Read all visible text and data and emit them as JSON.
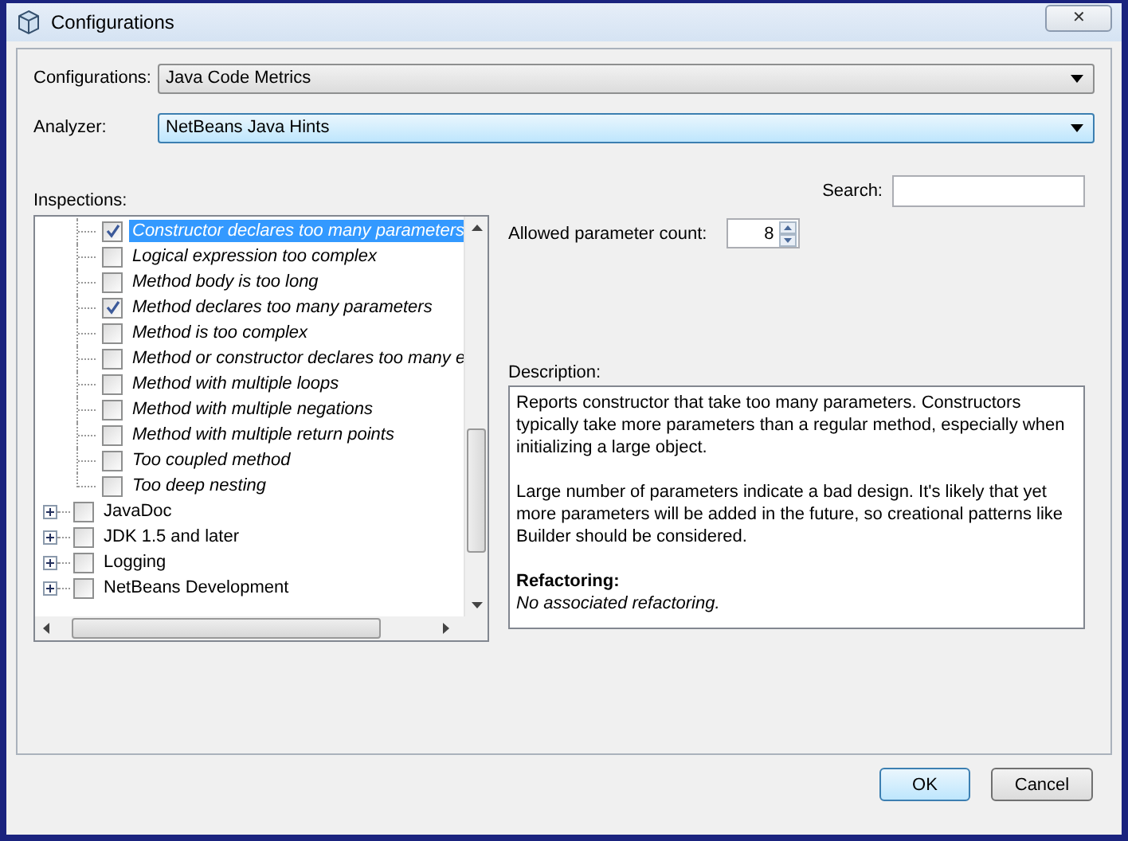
{
  "window": {
    "title": "Configurations",
    "close": "✕"
  },
  "configurations": {
    "label": "Configurations:",
    "value": "Java Code Metrics"
  },
  "analyzer": {
    "label": "Analyzer:",
    "value": "NetBeans Java Hints"
  },
  "inspections": {
    "label": "Inspections:",
    "open_group_children": [
      {
        "label": "Constructor declares too many parameters",
        "checked": true,
        "selected": true
      },
      {
        "label": "Logical expression too complex",
        "checked": false,
        "selected": false
      },
      {
        "label": "Method body is too long",
        "checked": false,
        "selected": false
      },
      {
        "label": "Method declares too many parameters",
        "checked": true,
        "selected": false
      },
      {
        "label": "Method is too complex",
        "checked": false,
        "selected": false
      },
      {
        "label": "Method or constructor declares too many e",
        "checked": false,
        "selected": false
      },
      {
        "label": "Method with multiple loops",
        "checked": false,
        "selected": false
      },
      {
        "label": "Method with multiple negations",
        "checked": false,
        "selected": false
      },
      {
        "label": "Method with multiple return points",
        "checked": false,
        "selected": false
      },
      {
        "label": "Too coupled method",
        "checked": false,
        "selected": false
      },
      {
        "label": "Too deep nesting",
        "checked": false,
        "selected": false
      }
    ],
    "groups": [
      {
        "label": "JavaDoc",
        "checked": false,
        "selected": false,
        "expanded": false
      },
      {
        "label": "JDK 1.5 and later",
        "checked": false,
        "selected": false,
        "expanded": false
      },
      {
        "label": "Logging",
        "checked": false,
        "selected": false,
        "expanded": false
      },
      {
        "label": "NetBeans Development",
        "checked": false,
        "selected": false,
        "expanded": false
      }
    ]
  },
  "search": {
    "label": "Search:"
  },
  "option": {
    "label": "Allowed parameter count:",
    "value": "8"
  },
  "description": {
    "label": "Description:",
    "paragraphs": [
      "Reports constructor that take too many parameters. Constructors typically take more parameters than a regular method, especially when initializing a large object.",
      "Large number of parameters indicate a bad design. It's likely that yet more parameters will be added in the future, so creational patterns like Builder should be considered."
    ],
    "refactoring_heading": "Refactoring:",
    "refactoring_text": "No associated refactoring."
  },
  "buttons": [
    {
      "label": "OK",
      "default": true
    },
    {
      "label": "Cancel",
      "default": false
    }
  ]
}
